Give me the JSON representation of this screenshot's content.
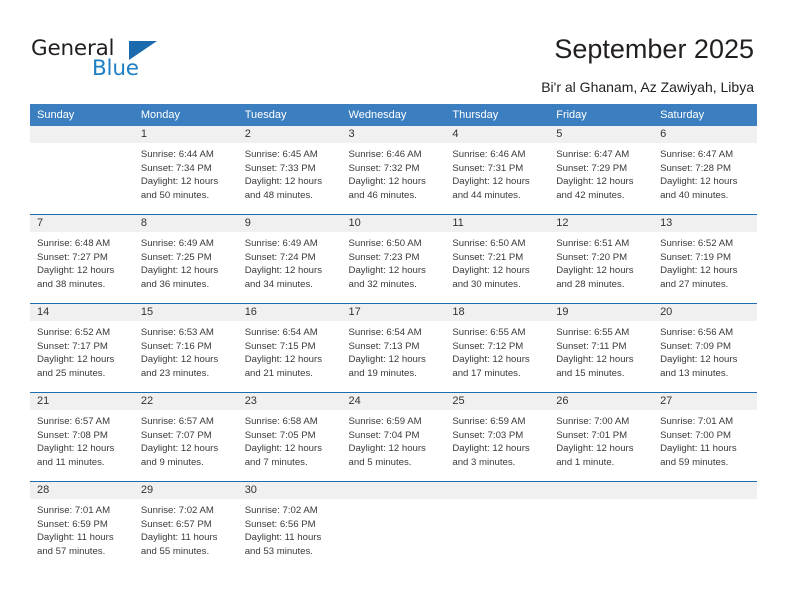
{
  "brand": {
    "name_part1": "General",
    "name_part2": "Blue",
    "triangle_icon": "triangle-icon",
    "accent_color": "#1f7fc4"
  },
  "header": {
    "title": "September 2025",
    "subtitle": "Bi'r al Ghanam, Az Zawiyah, Libya"
  },
  "theme": {
    "header_row_bg": "#3c7fc0",
    "header_row_text": "#ffffff",
    "daynum_bg": "#f0f0f0",
    "week_divider": "#1f6cb0",
    "body_text": "#3a3a3a"
  },
  "weekdays": [
    "Sunday",
    "Monday",
    "Tuesday",
    "Wednesday",
    "Thursday",
    "Friday",
    "Saturday"
  ],
  "weeks": [
    [
      {
        "day": "",
        "empty": true,
        "lines": []
      },
      {
        "day": "1",
        "lines": [
          "Sunrise: 6:44 AM",
          "Sunset: 7:34 PM",
          "Daylight: 12 hours",
          "and 50 minutes."
        ]
      },
      {
        "day": "2",
        "lines": [
          "Sunrise: 6:45 AM",
          "Sunset: 7:33 PM",
          "Daylight: 12 hours",
          "and 48 minutes."
        ]
      },
      {
        "day": "3",
        "lines": [
          "Sunrise: 6:46 AM",
          "Sunset: 7:32 PM",
          "Daylight: 12 hours",
          "and 46 minutes."
        ]
      },
      {
        "day": "4",
        "lines": [
          "Sunrise: 6:46 AM",
          "Sunset: 7:31 PM",
          "Daylight: 12 hours",
          "and 44 minutes."
        ]
      },
      {
        "day": "5",
        "lines": [
          "Sunrise: 6:47 AM",
          "Sunset: 7:29 PM",
          "Daylight: 12 hours",
          "and 42 minutes."
        ]
      },
      {
        "day": "6",
        "lines": [
          "Sunrise: 6:47 AM",
          "Sunset: 7:28 PM",
          "Daylight: 12 hours",
          "and 40 minutes."
        ]
      }
    ],
    [
      {
        "day": "7",
        "lines": [
          "Sunrise: 6:48 AM",
          "Sunset: 7:27 PM",
          "Daylight: 12 hours",
          "and 38 minutes."
        ]
      },
      {
        "day": "8",
        "lines": [
          "Sunrise: 6:49 AM",
          "Sunset: 7:25 PM",
          "Daylight: 12 hours",
          "and 36 minutes."
        ]
      },
      {
        "day": "9",
        "lines": [
          "Sunrise: 6:49 AM",
          "Sunset: 7:24 PM",
          "Daylight: 12 hours",
          "and 34 minutes."
        ]
      },
      {
        "day": "10",
        "lines": [
          "Sunrise: 6:50 AM",
          "Sunset: 7:23 PM",
          "Daylight: 12 hours",
          "and 32 minutes."
        ]
      },
      {
        "day": "11",
        "lines": [
          "Sunrise: 6:50 AM",
          "Sunset: 7:21 PM",
          "Daylight: 12 hours",
          "and 30 minutes."
        ]
      },
      {
        "day": "12",
        "lines": [
          "Sunrise: 6:51 AM",
          "Sunset: 7:20 PM",
          "Daylight: 12 hours",
          "and 28 minutes."
        ]
      },
      {
        "day": "13",
        "lines": [
          "Sunrise: 6:52 AM",
          "Sunset: 7:19 PM",
          "Daylight: 12 hours",
          "and 27 minutes."
        ]
      }
    ],
    [
      {
        "day": "14",
        "lines": [
          "Sunrise: 6:52 AM",
          "Sunset: 7:17 PM",
          "Daylight: 12 hours",
          "and 25 minutes."
        ]
      },
      {
        "day": "15",
        "lines": [
          "Sunrise: 6:53 AM",
          "Sunset: 7:16 PM",
          "Daylight: 12 hours",
          "and 23 minutes."
        ]
      },
      {
        "day": "16",
        "lines": [
          "Sunrise: 6:54 AM",
          "Sunset: 7:15 PM",
          "Daylight: 12 hours",
          "and 21 minutes."
        ]
      },
      {
        "day": "17",
        "lines": [
          "Sunrise: 6:54 AM",
          "Sunset: 7:13 PM",
          "Daylight: 12 hours",
          "and 19 minutes."
        ]
      },
      {
        "day": "18",
        "lines": [
          "Sunrise: 6:55 AM",
          "Sunset: 7:12 PM",
          "Daylight: 12 hours",
          "and 17 minutes."
        ]
      },
      {
        "day": "19",
        "lines": [
          "Sunrise: 6:55 AM",
          "Sunset: 7:11 PM",
          "Daylight: 12 hours",
          "and 15 minutes."
        ]
      },
      {
        "day": "20",
        "lines": [
          "Sunrise: 6:56 AM",
          "Sunset: 7:09 PM",
          "Daylight: 12 hours",
          "and 13 minutes."
        ]
      }
    ],
    [
      {
        "day": "21",
        "lines": [
          "Sunrise: 6:57 AM",
          "Sunset: 7:08 PM",
          "Daylight: 12 hours",
          "and 11 minutes."
        ]
      },
      {
        "day": "22",
        "lines": [
          "Sunrise: 6:57 AM",
          "Sunset: 7:07 PM",
          "Daylight: 12 hours",
          "and 9 minutes."
        ]
      },
      {
        "day": "23",
        "lines": [
          "Sunrise: 6:58 AM",
          "Sunset: 7:05 PM",
          "Daylight: 12 hours",
          "and 7 minutes."
        ]
      },
      {
        "day": "24",
        "lines": [
          "Sunrise: 6:59 AM",
          "Sunset: 7:04 PM",
          "Daylight: 12 hours",
          "and 5 minutes."
        ]
      },
      {
        "day": "25",
        "lines": [
          "Sunrise: 6:59 AM",
          "Sunset: 7:03 PM",
          "Daylight: 12 hours",
          "and 3 minutes."
        ]
      },
      {
        "day": "26",
        "lines": [
          "Sunrise: 7:00 AM",
          "Sunset: 7:01 PM",
          "Daylight: 12 hours",
          "and 1 minute."
        ]
      },
      {
        "day": "27",
        "lines": [
          "Sunrise: 7:01 AM",
          "Sunset: 7:00 PM",
          "Daylight: 11 hours",
          "and 59 minutes."
        ]
      }
    ],
    [
      {
        "day": "28",
        "lines": [
          "Sunrise: 7:01 AM",
          "Sunset: 6:59 PM",
          "Daylight: 11 hours",
          "and 57 minutes."
        ]
      },
      {
        "day": "29",
        "lines": [
          "Sunrise: 7:02 AM",
          "Sunset: 6:57 PM",
          "Daylight: 11 hours",
          "and 55 minutes."
        ]
      },
      {
        "day": "30",
        "lines": [
          "Sunrise: 7:02 AM",
          "Sunset: 6:56 PM",
          "Daylight: 11 hours",
          "and 53 minutes."
        ]
      },
      {
        "day": "",
        "empty": true,
        "lines": []
      },
      {
        "day": "",
        "empty": true,
        "lines": []
      },
      {
        "day": "",
        "empty": true,
        "lines": []
      },
      {
        "day": "",
        "empty": true,
        "lines": []
      }
    ]
  ]
}
